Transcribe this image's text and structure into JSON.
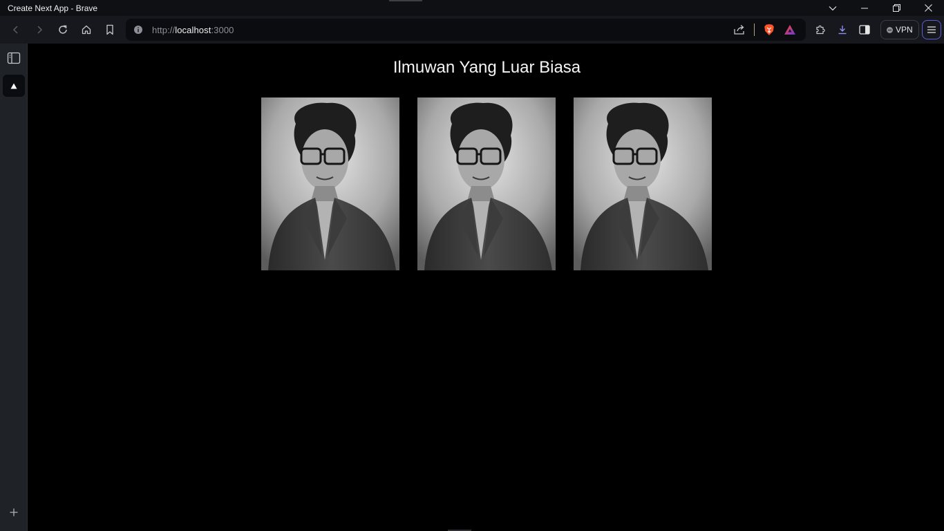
{
  "window": {
    "title": "Create Next App - Brave"
  },
  "toolbar": {
    "url_scheme": "http://",
    "url_host": "localhost",
    "url_port": ":3000",
    "vpn_label": "VPN"
  },
  "page": {
    "heading": "Ilmuwan Yang Luar Biasa",
    "images": [
      {
        "name": "scientist-portrait-1"
      },
      {
        "name": "scientist-portrait-2"
      },
      {
        "name": "scientist-portrait-3"
      }
    ]
  },
  "icons": {
    "back": "arrow-left-icon",
    "forward": "arrow-right-icon",
    "reload": "reload-icon",
    "home": "home-icon",
    "bookmark": "bookmark-icon",
    "site_info": "info-icon",
    "share": "share-icon",
    "brave_shields": "brave-shields-icon",
    "brave_rewards": "brave-rewards-icon",
    "extensions": "puzzle-icon",
    "downloads": "download-icon",
    "sidebar_toggle": "sidebar-icon",
    "menu": "hamburger-menu-icon"
  },
  "colors": {
    "page_background": "#000000",
    "brave_orange": "#fb542b",
    "rewards_purple": "#6b36e3",
    "menu_border": "#5b5fd8"
  }
}
